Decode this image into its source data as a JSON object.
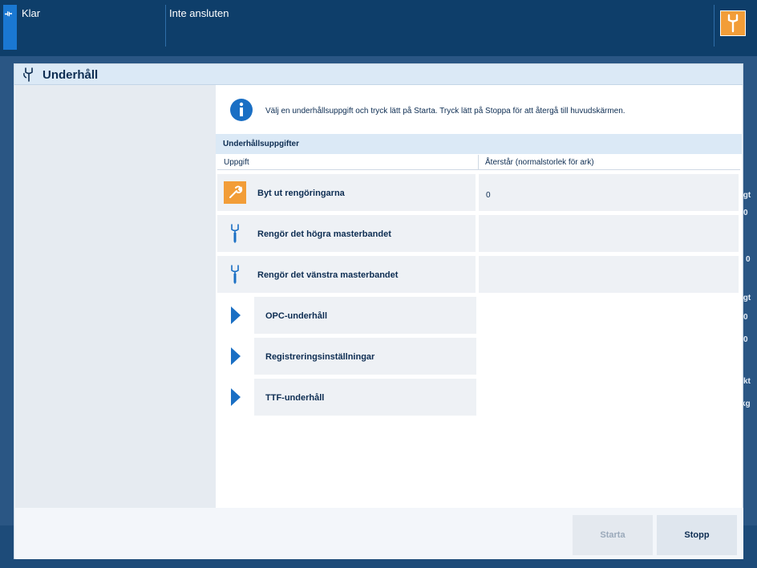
{
  "topbar": {
    "status_icon": "status-icon",
    "status": "Klar",
    "connection": "Inte ansluten",
    "tool_icon": "wrench-icon"
  },
  "background": {
    "values": [
      "igt",
      "0",
      "0",
      "igt",
      "0",
      "0",
      "kt",
      "kg"
    ]
  },
  "dialog": {
    "title": "Underhåll",
    "title_icon": "maintenance-hand-icon",
    "info_text": "Välj en underhållsuppgift och tryck lätt på Starta. Tryck lätt på Stoppa för att återgå till huvudskärmen.",
    "section_title": "Underhållsuppgifter",
    "columns": [
      "Uppgift",
      "Återstår (normalstorlek för ark)"
    ],
    "tasks": [
      {
        "label": "Byt ut rengöringarna",
        "value": "0",
        "icon": "wrench-icon",
        "highlight": true
      },
      {
        "label": "Rengör det högra masterbandet",
        "value": "",
        "icon": "hand-tool-icon",
        "highlight": false
      },
      {
        "label": "Rengör det vänstra masterbandet",
        "value": "",
        "icon": "hand-tool-icon",
        "highlight": false
      }
    ],
    "nav_items": [
      {
        "label": "OPC-underhåll"
      },
      {
        "label": "Registreringsinställningar"
      },
      {
        "label": "TTF-underhåll"
      }
    ],
    "buttons": {
      "start": "Starta",
      "stop": "Stopp"
    }
  },
  "colors": {
    "topbar": "#0e3e6a",
    "accent": "#1a78d2",
    "orange": "#f29d38",
    "header": "#dbe9f6"
  }
}
